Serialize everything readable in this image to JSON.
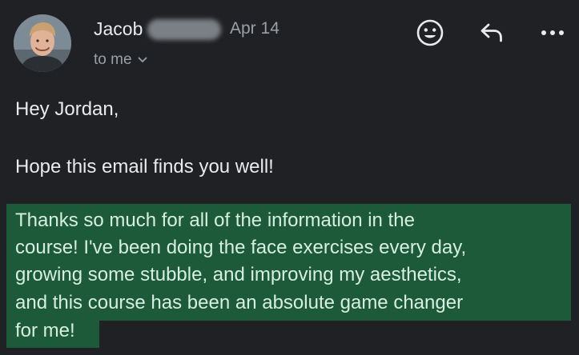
{
  "email": {
    "sender": {
      "name": "Jacob",
      "avatar_icon": "person-avatar-icon"
    },
    "date": "Apr 14",
    "recipients_label": "to me",
    "actions": {
      "emoji_icon": "smiley-icon",
      "reply_icon": "reply-arrow-icon",
      "more_icon": "more-options-icon"
    },
    "body": {
      "greeting": "Hey Jordan,",
      "opener": "Hope this email finds you well!",
      "highlighted_lines": [
        "Thanks so much for all of the information in the",
        "course! I've been doing the face exercises every day,",
        "growing some stubble, and improving my aesthetics,",
        "and this course has been an absolute game changer",
        "for me!"
      ]
    }
  },
  "colors": {
    "background": "#202124",
    "primary_text": "#e8eaed",
    "secondary_text": "#9aa0a6",
    "highlight": "#1d5a3a"
  }
}
